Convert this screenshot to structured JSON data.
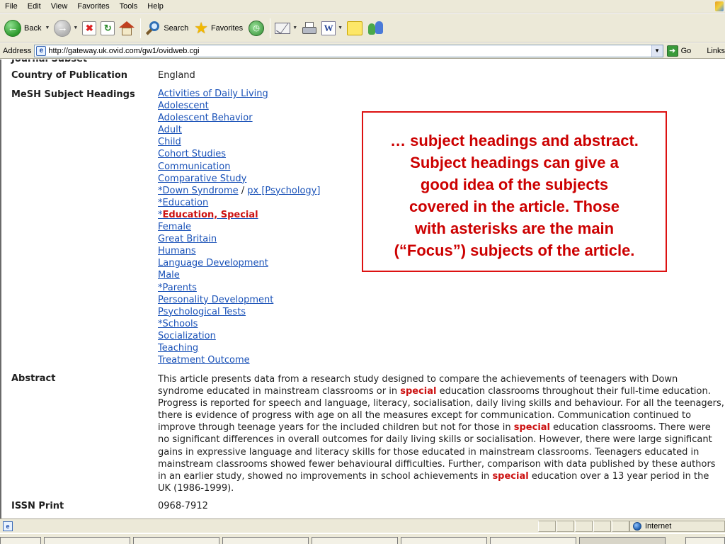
{
  "menubar": {
    "items": [
      "File",
      "Edit",
      "View",
      "Favorites",
      "Tools",
      "Help"
    ]
  },
  "toolbar": {
    "back_label": "Back",
    "search_label": "Search",
    "favorites_label": "Favorites"
  },
  "address": {
    "label": "Address",
    "url": "http://gateway.uk.ovid.com/gw1/ovidweb.cgi",
    "go_label": "Go",
    "links_label": "Links"
  },
  "record": {
    "country_label": "Country of Publication",
    "country_value": "England",
    "mesh_label": "MeSH Subject Headings",
    "mesh_items": [
      "Activities of Daily Living",
      "Adolescent",
      "Adolescent Behavior",
      "Adult",
      "Child",
      "Cohort Studies",
      "Communication",
      "Comparative Study",
      "*Down Syndrome",
      "px [Psychology]",
      "*Education",
      "Education, Special",
      "Female",
      "Great Britain",
      "Humans",
      "Language Development",
      "Male",
      "*Parents",
      "Personality Development",
      "Psychological Tests",
      "*Schools",
      "Socialization",
      "Teaching",
      "Treatment Outcome"
    ],
    "slash": "/",
    "asterisk": "*",
    "abstract_label": "Abstract",
    "abstract_parts": [
      "This article presents data from a research study designed to compare the achievements of teenagers with Down syndrome educated in mainstream classrooms or in ",
      "special",
      " education classrooms throughout their full-time education. Progress is reported for speech and language, literacy, socialisation, daily living skills and behaviour. For all the teenagers, there is evidence of progress with age on all the measures except for communication. Communication continued to improve through teenage years for the included children but not for those in ",
      "special",
      " education classrooms. There were no significant differences in overall outcomes for daily living skills or socialisation. However, there were large significant gains in expressive language and literacy skills for those educated in mainstream classrooms. Teenagers educated in mainstream classrooms showed fewer behavioural difficulties. Further, comparison with data published by these authors in an earlier study, showed no improvements in school achievements in ",
      "special",
      " education over a 13 year period in the UK (1986-1999)."
    ],
    "issn_label": "ISSN Print",
    "issn_value": "0968-7912"
  },
  "callout": {
    "lines": [
      "… subject headings and abstract.",
      "Subject headings can give a",
      "good idea of the subjects",
      "covered in the article.  Those",
      "with asterisks are the main",
      "(“Focus”) subjects of the article."
    ]
  },
  "statusbar": {
    "zone": "Internet"
  },
  "colors": {
    "link": "#1a52b8",
    "highlight": "#cc1111",
    "callout_border": "#dd1111",
    "chrome": "#ece9d8"
  },
  "icons": [
    "back-arrow-icon",
    "forward-arrow-icon",
    "stop-icon",
    "refresh-icon",
    "home-icon",
    "search-icon",
    "favorites-star-icon",
    "history-icon",
    "mail-icon",
    "print-icon",
    "edit-icon",
    "discuss-note-icon",
    "messenger-icon",
    "page-icon",
    "go-arrow-icon",
    "globe-icon"
  ]
}
